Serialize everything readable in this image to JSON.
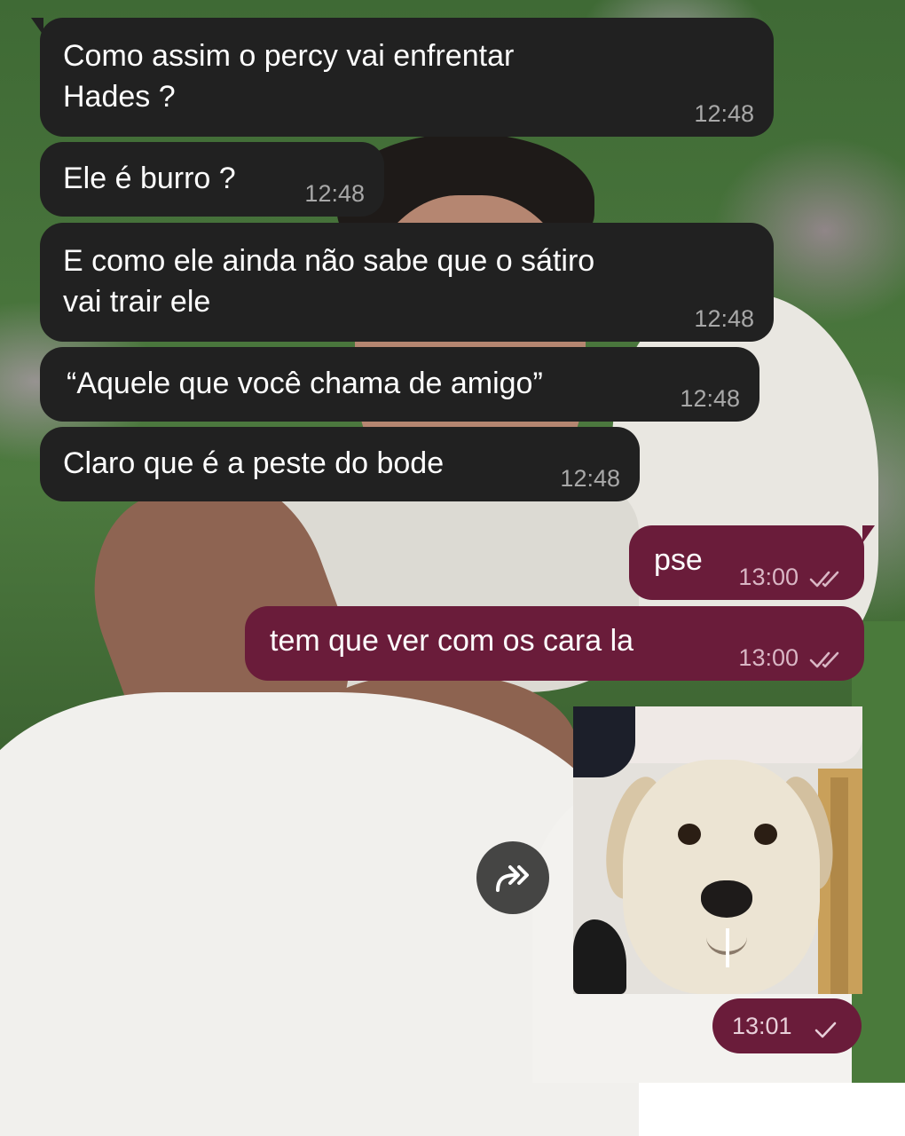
{
  "messages": [
    {
      "direction": "incoming",
      "text": "Como assim o percy vai enfrentar\nHades ?",
      "time": "12:48"
    },
    {
      "direction": "incoming",
      "text": "Ele é burro ?",
      "time": "12:48"
    },
    {
      "direction": "incoming",
      "text": "E como ele ainda não sabe que o sátiro\nvai trair ele",
      "time": "12:48"
    },
    {
      "direction": "incoming",
      "text": "“Aquele que você chama de amigo”",
      "time": "12:48"
    },
    {
      "direction": "incoming",
      "text": "Claro que é a peste do bode",
      "time": "12:48"
    },
    {
      "direction": "outgoing",
      "text": "pse",
      "time": "13:00",
      "status": "read"
    },
    {
      "direction": "outgoing",
      "text": "tem que ver com os cara la",
      "time": "13:00",
      "status": "read"
    }
  ],
  "sticker_message": {
    "direction": "outgoing",
    "content": "dog-sticker",
    "time": "13:01",
    "status": "sent"
  },
  "icons": {
    "forward": "forward-icon",
    "read_status": "double-check-icon",
    "sent_status": "check-icon"
  },
  "colors": {
    "incoming_bubble": "#212121",
    "outgoing_bubble": "#6a1c3a",
    "text": "#ffffff",
    "incoming_time": "#a8a8a8",
    "outgoing_time": "#d9b6c4"
  }
}
